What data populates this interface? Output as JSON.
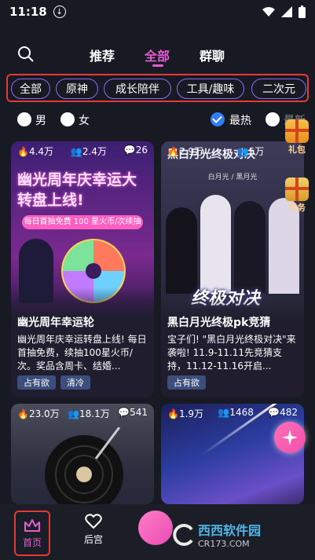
{
  "status": {
    "time": "11:18"
  },
  "nav": {
    "tabs": [
      "推荐",
      "全部",
      "群聊"
    ],
    "active_tab": "全部"
  },
  "categories": [
    "全部",
    "原神",
    "成长陪伴",
    "工具/趣味",
    "二次元"
  ],
  "filters": {
    "male": "男",
    "female": "女",
    "hot": "最热",
    "new": "最新"
  },
  "side": {
    "gift": "礼包",
    "task": "任务"
  },
  "cards": [
    {
      "views": "4.4万",
      "users": "2.4万",
      "comments": "26",
      "banner": "幽光周年庆幸运大转盘上线!",
      "banner_sub": "每日首抽免费 100 星火币/次续抽",
      "title": "幽光周年幸运轮",
      "desc": "幽光周年庆幸运转盘上线! 每日首抽免费，续抽100星火币/次。奖品含周卡、结婚...",
      "tags": [
        "占有欲",
        "清冷"
      ]
    },
    {
      "views": "2.9万",
      "users": "5万",
      "comments": "",
      "banner": "黑白月光终极对决",
      "banner_label": "白月光 / 黑月光",
      "overlay": "终极对决",
      "title": "黑白月光终极pk竞猜",
      "desc": "宝子们! \"黑白月光终极对决\"来袭啦! 11.9-11.11先竞猜支持，11.12-11.16开启...",
      "tags": [
        "占有欲"
      ]
    },
    {
      "views": "23.0万",
      "users": "18.1万",
      "comments": "541"
    },
    {
      "views": "1.9万",
      "users": "1468",
      "comments": "482"
    }
  ],
  "bottom_nav": {
    "home": "首页",
    "harem": "后宫"
  },
  "watermark": {
    "name": "西西软件园",
    "url": "CR173.COM"
  },
  "colors": {
    "accent": "#e55cd4",
    "highlight_border": "#e53935",
    "chip_border": "#8e6cf2"
  }
}
